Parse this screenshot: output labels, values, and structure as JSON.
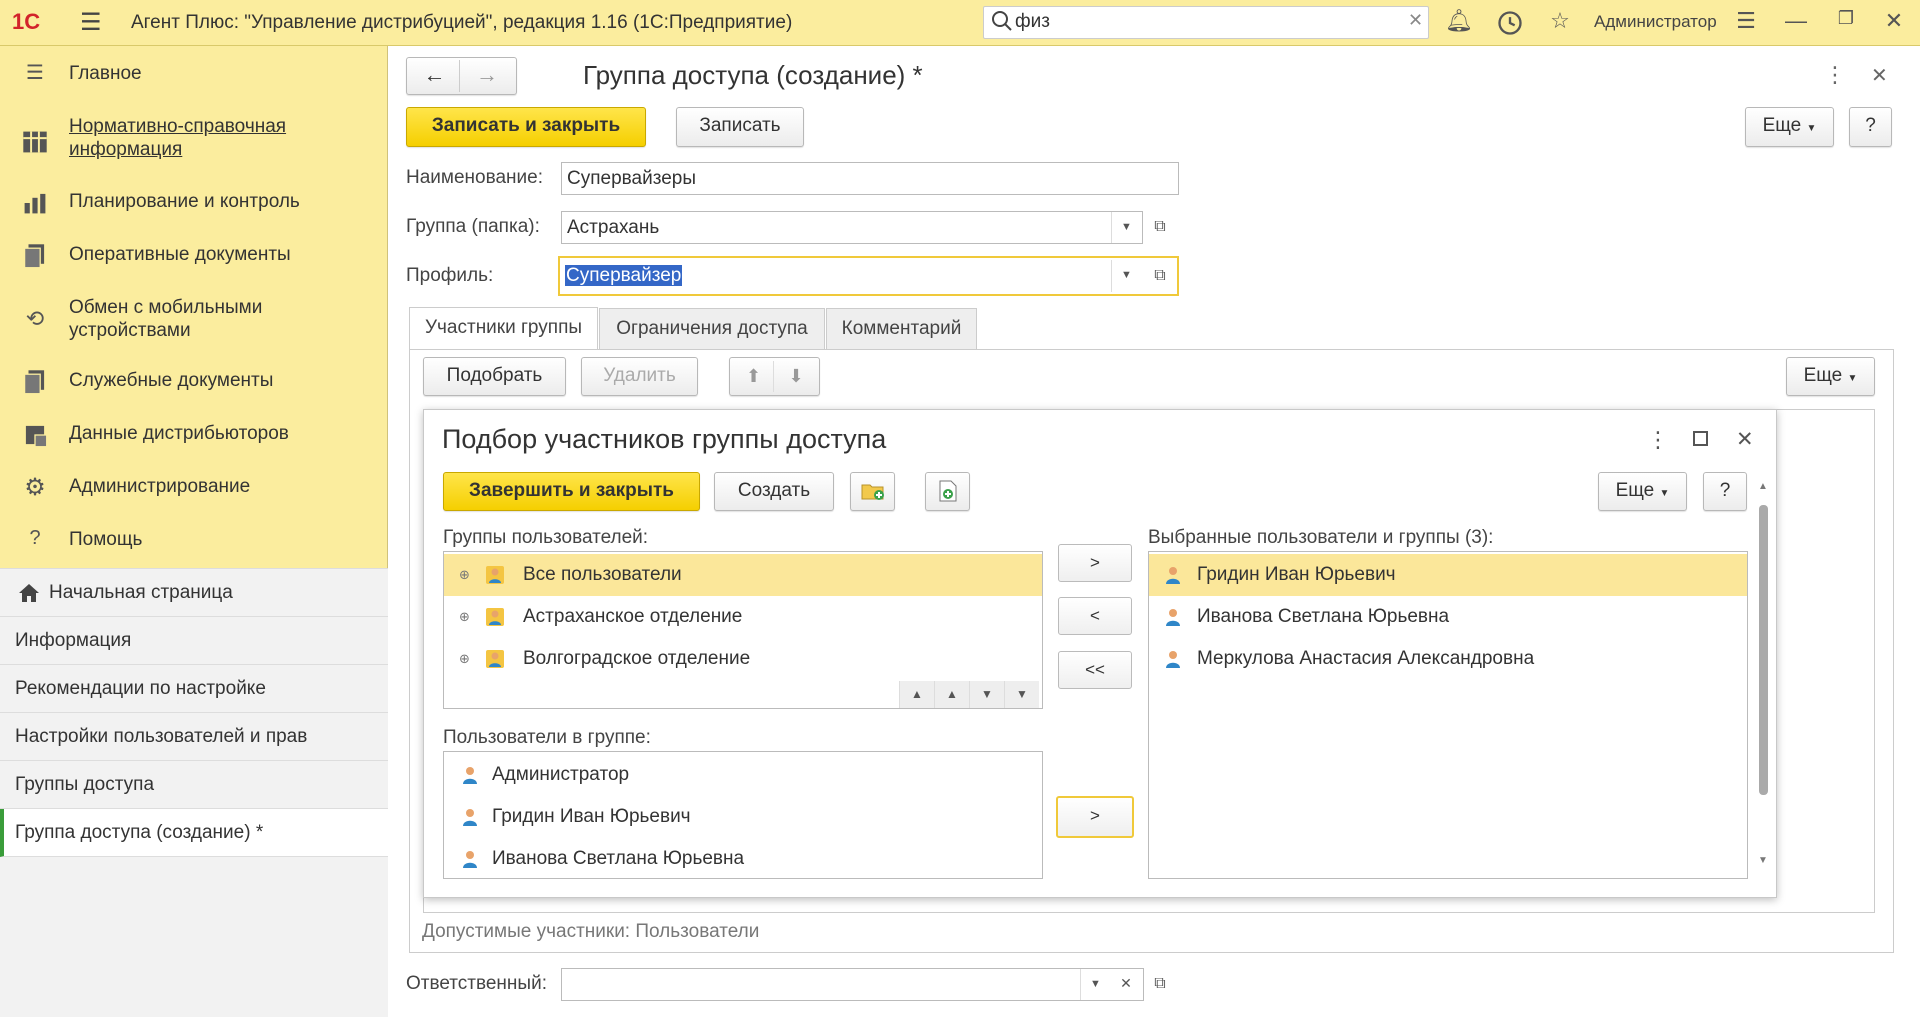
{
  "app": {
    "logo": "1С",
    "title": "Агент Плюс: \"Управление дистрибуцией\", редакция 1.16  (1С:Предприятие)",
    "search_value": "физ",
    "user": "Администратор"
  },
  "sidebar": {
    "sections": [
      {
        "label": "Главное",
        "icon": "menu-icon"
      },
      {
        "label": "Нормативно-справочная информация",
        "icon": "grid-icon"
      },
      {
        "label": "Планирование и контроль",
        "icon": "chart-icon"
      },
      {
        "label": "Оперативные документы",
        "icon": "document-icon"
      },
      {
        "label": "Обмен с мобильными устройствами",
        "icon": "sync-icon"
      },
      {
        "label": "Служебные документы",
        "icon": "document-icon"
      },
      {
        "label": "Данные дистрибьюторов",
        "icon": "data-icon"
      },
      {
        "label": "Администрирование",
        "icon": "gear-icon"
      },
      {
        "label": "Помощь",
        "icon": "help-icon"
      }
    ],
    "open_windows": [
      "Начальная страница",
      "Информация",
      "Рекомендации по настройке",
      "Настройки пользователей и прав",
      "Группы доступа",
      "Группа доступа (создание) *"
    ]
  },
  "form": {
    "title": "Группа доступа (создание) *",
    "save_close": "Записать и закрыть",
    "save": "Записать",
    "more": "Еще",
    "help": "?",
    "name_label": "Наименование:",
    "name_value": "Супервайзеры",
    "group_label": "Группа (папка):",
    "group_value": "Астрахань",
    "profile_label": "Профиль:",
    "profile_value": "Супервайзер",
    "tabs": [
      "Участники группы",
      "Ограничения доступа",
      "Комментарий"
    ],
    "pick": "Подобрать",
    "delete": "Удалить",
    "allowed": "Допустимые участники: Пользователи",
    "responsible_label": "Ответственный:",
    "responsible_value": ""
  },
  "dialog": {
    "title": "Подбор участников группы доступа",
    "finish": "Завершить и закрыть",
    "create": "Создать",
    "more": "Еще",
    "help": "?",
    "groups_label": "Группы пользователей:",
    "groups": [
      "Все пользователи",
      "Астраханское отделение",
      "Волгоградское отделение"
    ],
    "users_label": "Пользователи в группе:",
    "users": [
      "Администратор",
      "Гридин Иван Юрьевич",
      "Иванова Светлана Юрьевна"
    ],
    "selected_label": "Выбранные пользователи и группы (3):",
    "selected": [
      "Гридин Иван Юрьевич",
      "Иванова Светлана Юрьевна",
      "Меркулова Анастасия Александровна"
    ],
    "btn_add": ">",
    "btn_remove": "<",
    "btn_remove_all": "<<",
    "btn_add_user": ">"
  }
}
